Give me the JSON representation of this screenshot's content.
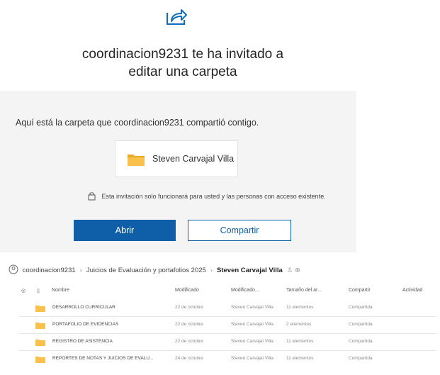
{
  "email": {
    "icon": "share-arrow-icon",
    "title_line1": "coordinacion9231 te ha invitado a",
    "title_line2": "editar una carpeta",
    "description": "Aquí está la carpeta que coordinacion9231 compartió contigo.",
    "folder_name": "Steven Carvajal Villa",
    "notice": "Esta invitación solo funcionará para usted y las personas con acceso existente.",
    "open_label": "Abrir",
    "share_label": "Compartir",
    "colors": {
      "accent": "#0f5fa8",
      "folder": "#f7c14b",
      "card_bg": "#f4f4f4"
    }
  },
  "breadcrumb": {
    "items": [
      "coordinacion9231",
      "Juicios de Evaluación y portafolios 2025",
      "Steven Carvajal Villa"
    ]
  },
  "list": {
    "columns": [
      "Nombre",
      "Modificado",
      "Modificado...",
      "Tamaño del ar...",
      "Compartir",
      "Actividad"
    ],
    "rows": [
      {
        "name": "DESARROLLO CURRICULAR",
        "modified": "22 de octubre",
        "modified_by": "Steven Carvajal Villa",
        "size": "11 elementos",
        "sharing": "Compartida"
      },
      {
        "name": "PORTAFOLIO DE EVIDENCIAS",
        "modified": "22 de octubre",
        "modified_by": "Steven Carvajal Villa",
        "size": "2 elementos",
        "sharing": "Compartida"
      },
      {
        "name": "REGISTRO DE ASISTENCIA",
        "modified": "22 de octubre",
        "modified_by": "Steven Carvajal Villa",
        "size": "11 elementos",
        "sharing": "Compartida"
      },
      {
        "name": "REPORTES DE NOTAS Y JUICIOS DE EVALU...",
        "modified": "24 de octubre",
        "modified_by": "Steven Carvajal Villa",
        "size": "11 elementos",
        "sharing": "Compartida"
      }
    ]
  }
}
